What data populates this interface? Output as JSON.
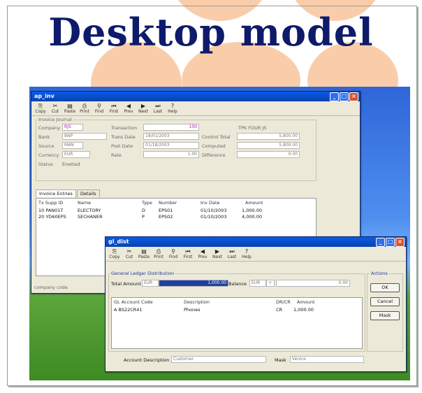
{
  "slide": {
    "title": "Desktop model",
    "colors": {
      "title": "#0e1a6a",
      "blob": "#f8c8a0",
      "titlebar": "#0a5ce8"
    }
  },
  "window1": {
    "title": "ap_inv",
    "toolbar": [
      {
        "label": "Copy",
        "icon": "copy-icon",
        "glyph": "⎘"
      },
      {
        "label": "Cut",
        "icon": "cut-icon",
        "glyph": "✂"
      },
      {
        "label": "Paste",
        "icon": "paste-icon",
        "glyph": "▤"
      },
      {
        "label": "Print",
        "icon": "print-icon",
        "glyph": "⎙"
      },
      {
        "label": "Find",
        "icon": "binoculars-icon",
        "glyph": "⚲"
      },
      {
        "label": "First",
        "icon": "first-icon",
        "glyph": "⏮"
      },
      {
        "label": "Prev",
        "icon": "prev-icon",
        "glyph": "◀"
      },
      {
        "label": "Next",
        "icon": "next-icon",
        "glyph": "▶"
      },
      {
        "label": "Last",
        "icon": "last-icon",
        "glyph": "⏭"
      },
      {
        "label": "Help",
        "icon": "help-icon",
        "glyph": "?"
      }
    ],
    "group_label": "Invoice Journal",
    "fields": {
      "company_label": "Company",
      "company_value": "RJS",
      "bank_label": "Bank",
      "bank_value": "BNP",
      "source_label": "Source",
      "source_value": "MAN",
      "currency_label": "Currency",
      "currency_value": "EUR",
      "status_label": "Status",
      "status_value": "Enetted",
      "transaction_label": "Transaction",
      "transaction_value": "100",
      "trans_date_label": "Trans Date",
      "trans_date_value": "18/01/2003",
      "post_date_label": "Post Date",
      "post_date_value": "01/18/2003",
      "rate_label": "Rate",
      "rate_value": "1.00",
      "extra_label": "TPK FOUR JS",
      "control_total_label": "Control Total",
      "control_total_value": "5,800.00",
      "computed_label": "Computed",
      "computed_value": "5,800.00",
      "difference_label": "Difference",
      "difference_value": "0.00"
    },
    "tabs": [
      "Invoice Entries",
      "Details"
    ],
    "grid": {
      "headers": [
        "Tx Supp ID",
        "Name",
        "Type",
        "Number",
        "Inv Date",
        "Amount"
      ],
      "rows": [
        [
          "10 PAN01T",
          "ELECTORY",
          "D",
          "EPS01",
          "01/10/2003",
          "1,000.00"
        ],
        [
          "20 YD60EPS",
          "SECHANER",
          "P",
          "EPS02",
          "01/10/2003",
          "4,000.00"
        ]
      ]
    },
    "status_bar": "company code"
  },
  "window2": {
    "title": "gl_dist",
    "toolbar": [
      {
        "label": "Copy",
        "icon": "copy-icon",
        "glyph": "⎘"
      },
      {
        "label": "Cut",
        "icon": "cut-icon",
        "glyph": "✂"
      },
      {
        "label": "Paste",
        "icon": "paste-icon",
        "glyph": "▤"
      },
      {
        "label": "Print",
        "icon": "print-icon",
        "glyph": "⎙"
      },
      {
        "label": "Find",
        "icon": "binoculars-icon",
        "glyph": "⚲"
      },
      {
        "label": "First",
        "icon": "first-icon",
        "glyph": "⏮"
      },
      {
        "label": "Prev",
        "icon": "prev-icon",
        "glyph": "◀"
      },
      {
        "label": "Next",
        "icon": "next-icon",
        "glyph": "▶"
      },
      {
        "label": "Last",
        "icon": "last-icon",
        "glyph": "⏭"
      },
      {
        "label": "Help",
        "icon": "help-icon",
        "glyph": "?"
      }
    ],
    "group_label": "General Ledger Distribution",
    "total_amount_label": "Total Amount",
    "total_currency": "EUR",
    "total_value": "1,000.00",
    "balance_label": "Balance",
    "balance_currency": "EUR",
    "balance_sign": "+",
    "balance_value": "0.00",
    "grid": {
      "headers": [
        "GL Account Code",
        "Description",
        "DR/CR",
        "Amount"
      ],
      "rows": [
        [
          "A  BS22CR41",
          "Phones",
          "CR",
          "1,000.00"
        ]
      ]
    },
    "actions_label": "Actions",
    "actions": [
      "OK",
      "Cancel",
      "Mask"
    ],
    "account_description_label": "Account Description",
    "account_description_value": "Customer",
    "mask_label": "Mask",
    "mask_value": "Venice"
  }
}
